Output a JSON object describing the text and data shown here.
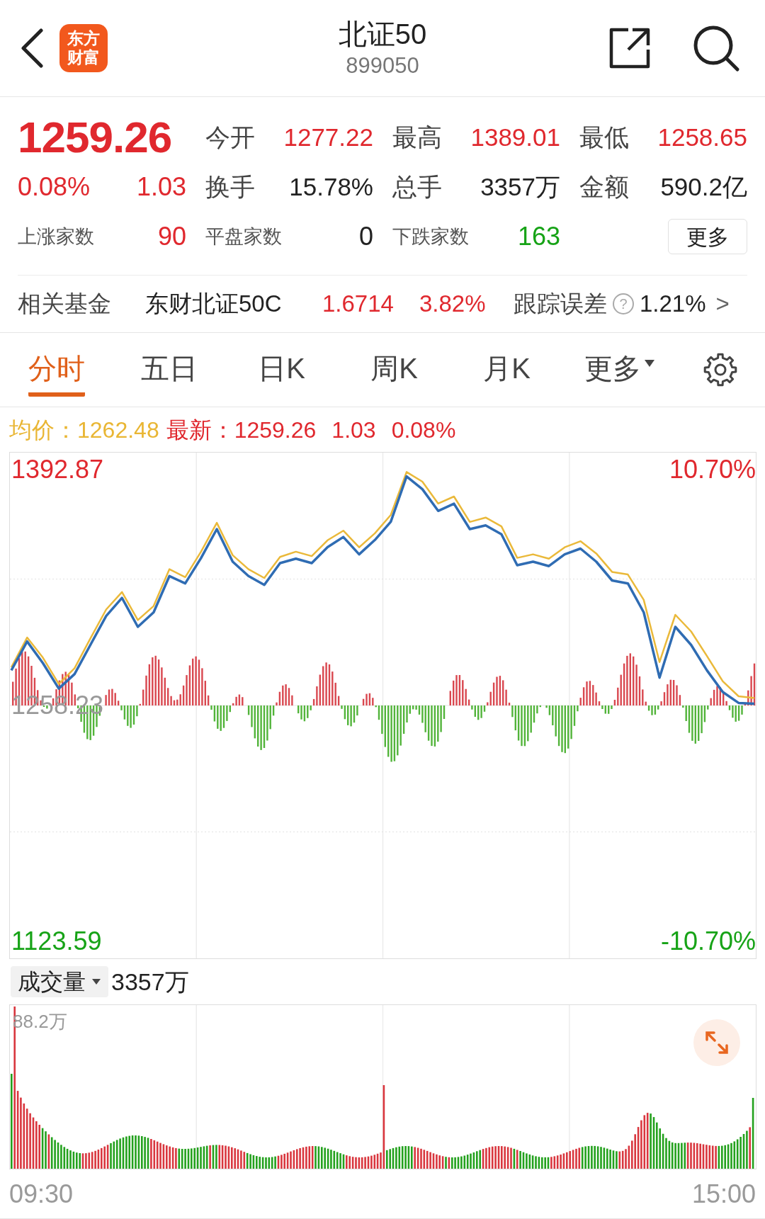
{
  "header": {
    "logo_lines": [
      "东方",
      "财富"
    ],
    "title": "北证50",
    "code": "899050"
  },
  "quote": {
    "price": "1259.26",
    "change_pct": "0.08%",
    "change": "1.03",
    "color": "#e0282e",
    "stats": [
      {
        "label": "今开",
        "value": "1277.22",
        "color": "#e0282e"
      },
      {
        "label": "最高",
        "value": "1389.01",
        "color": "#e0282e"
      },
      {
        "label": "最低",
        "value": "1258.65",
        "color": "#e0282e"
      },
      {
        "label": "换手",
        "value": "15.78%",
        "color": "#222222"
      },
      {
        "label": "总手",
        "value": "3357万",
        "color": "#222222"
      },
      {
        "label": "金额",
        "value": "590.2亿",
        "color": "#222222"
      }
    ],
    "breadth": [
      {
        "label": "上涨家数",
        "value": "90",
        "color": "#e0282e"
      },
      {
        "label": "平盘家数",
        "value": "0",
        "color": "#222222"
      },
      {
        "label": "下跌家数",
        "value": "163",
        "color": "#17a317"
      }
    ],
    "more_button": "更多"
  },
  "fund": {
    "label": "相关基金",
    "name": "东财北证50C",
    "price": "1.6714",
    "change_pct": "3.82%",
    "tracking_label": "跟踪误差",
    "help_icon": "?",
    "tracking_error": "1.21%",
    "chevron": ">"
  },
  "tabs": [
    {
      "label": "分时",
      "selected": true,
      "dropdown": false
    },
    {
      "label": "五日",
      "selected": false,
      "dropdown": false
    },
    {
      "label": "日K",
      "selected": false,
      "dropdown": false
    },
    {
      "label": "周K",
      "selected": false,
      "dropdown": false
    },
    {
      "label": "月K",
      "selected": false,
      "dropdown": false
    },
    {
      "label": "更多",
      "selected": false,
      "dropdown": true
    }
  ],
  "summary": {
    "avg_label": "均价：",
    "avg_value": "1262.48",
    "latest_label": "最新：",
    "latest_value": "1259.26",
    "latest_change": "1.03",
    "latest_pct": "0.08%"
  },
  "intraday": {
    "chart_data": {
      "type": "line",
      "categories": [
        null,
        null,
        null,
        null,
        null,
        null,
        null,
        null,
        null,
        null,
        null,
        null,
        null,
        null,
        null,
        null,
        null,
        null,
        null,
        null,
        null,
        null,
        null,
        null,
        null,
        null,
        null,
        null,
        null,
        null,
        null,
        null,
        null,
        null,
        null,
        null,
        null,
        null,
        null,
        null,
        null,
        null,
        null,
        null,
        null,
        null,
        null,
        null
      ],
      "series": [
        {
          "color": "#2f6cb3",
          "values": [
            1278.3,
            1294.8,
            1282.4,
            1267.9,
            1276.2,
            1292.8,
            1309.3,
            1319.6,
            1303.1,
            1311.4,
            1332.1,
            1327.9,
            1342.4,
            1358.9,
            1340.3,
            1332.1,
            1327.1,
            1339.5,
            1342.0,
            1339.5,
            1348.6,
            1354.4,
            1344.5,
            1352.7,
            1363.1,
            1389.0,
            1381.7,
            1369.3,
            1373.4,
            1358.9,
            1361.0,
            1356.0,
            1338.3,
            1340.3,
            1337.8,
            1344.5,
            1347.8,
            1340.3,
            1329.6,
            1327.9,
            1311.4,
            1274.1,
            1303.1,
            1292.8,
            1278.3,
            1265.9,
            1259.7,
            1259.3
          ]
        },
        {
          "color": "#eab93a",
          "values": [
            1280.0,
            1297.0,
            1285.5,
            1270.5,
            1279.5,
            1296.5,
            1313.0,
            1323.0,
            1307.0,
            1315.0,
            1336.0,
            1331.5,
            1346.0,
            1362.5,
            1344.0,
            1336.0,
            1331.0,
            1343.0,
            1346.0,
            1343.5,
            1352.5,
            1358.0,
            1348.5,
            1356.5,
            1367.0,
            1391.5,
            1386.0,
            1373.5,
            1377.5,
            1363.0,
            1365.5,
            1360.5,
            1342.5,
            1344.5,
            1342.0,
            1348.5,
            1352.0,
            1345.0,
            1334.5,
            1333.0,
            1318.5,
            1283.0,
            1310.0,
            1300.5,
            1286.5,
            1272.0,
            1263.5,
            1262.5
          ]
        }
      ],
      "ylim": [
        1113.89,
        1402.57
      ],
      "yticks": [
        {
          "value": 1392.87,
          "label": "1392.87"
        },
        {
          "value": 1258.23,
          "label": "1258.23"
        },
        {
          "value": 1123.59,
          "label": "1123.59"
        }
      ]
    },
    "right_labels": [
      {
        "label": "10.70%",
        "color": "#e0282e"
      },
      {
        "label": "-10.70%",
        "color": "#17a317"
      }
    ]
  },
  "volume": {
    "selector": "成交量",
    "total": "3357万",
    "max_label": "88.2万"
  },
  "time_labels": [
    "09:30",
    "15:00"
  ]
}
